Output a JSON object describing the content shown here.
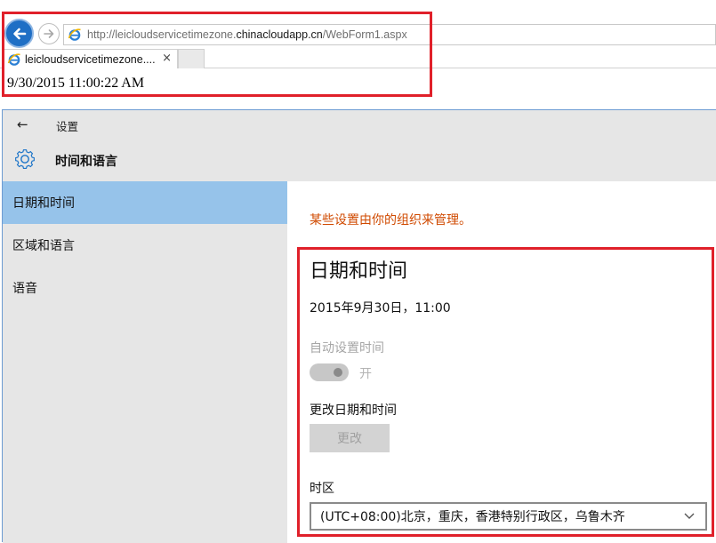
{
  "browser": {
    "url_prefix": "http://leicloudservicetimezone.",
    "url_domain": "chinacloudapp.cn",
    "url_path": "/WebForm1.aspx",
    "tab_title": "leicloudservicetimezone....",
    "tab_close": "×",
    "page_text": "9/30/2015 11:00:22 AM",
    "back_icon": "back-arrow-icon",
    "forward_icon": "forward-arrow-icon",
    "site_icon": "ie-icon"
  },
  "settings": {
    "title": "设置",
    "back_glyph": "←",
    "header_title": "时间和语言",
    "header_icon": "gear-icon",
    "sidebar": {
      "items": [
        {
          "label": "日期和时间",
          "selected": true
        },
        {
          "label": "区域和语言",
          "selected": false
        },
        {
          "label": "语音",
          "selected": false
        }
      ]
    },
    "content": {
      "managed_note": "某些设置由你的组织来管理。",
      "section_title": "日期和时间",
      "current_datetime": "2015年9月30日，11:00",
      "auto_time_label": "自动设置时间",
      "auto_time_state": "开",
      "change_label": "更改日期和时间",
      "change_button": "更改",
      "timezone_label": "时区",
      "timezone_value": "(UTC+08:00)北京，重庆，香港特别行政区，乌鲁木齐"
    }
  },
  "colors": {
    "accent_selected": "#96c3ea",
    "managed_note": "#d04a00",
    "highlight": "#e0202a",
    "ie_back": "#1f6fc5"
  }
}
